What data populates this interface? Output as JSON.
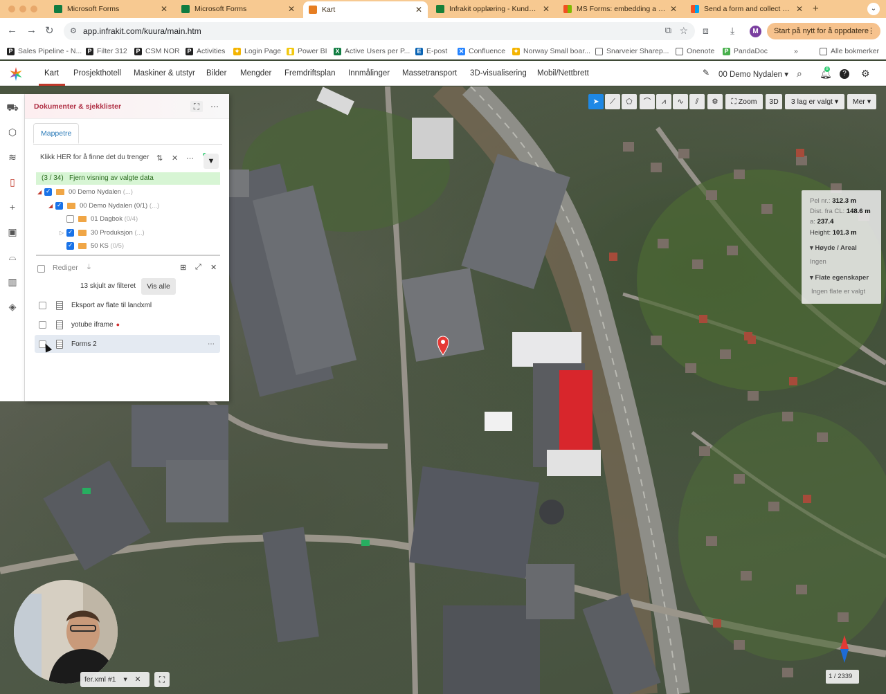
{
  "browser": {
    "tabs": [
      {
        "label": "Microsoft Forms",
        "color": "#107c41"
      },
      {
        "label": "Microsoft Forms",
        "color": "#107c41"
      },
      {
        "label": "Kart",
        "color": "#e67e22"
      },
      {
        "label": "Infrakit opplæring - Kundetilf",
        "color": "#188038"
      },
      {
        "label": "MS Forms: embedding a form",
        "color": "#f25022"
      },
      {
        "label": "Send a form and collect resp",
        "color": "#f25022"
      }
    ],
    "url": "app.infrakit.com/kuura/main.htm",
    "profile_initial": "M",
    "update_label": "Start på nytt for å oppdatere",
    "bookmarks": [
      "Sales Pipeline - N...",
      "Filter 312",
      "CSM NOR",
      "Activities",
      "Login Page",
      "Power BI",
      "Active Users per P...",
      "E-post",
      "Confluence",
      "Norway Small boar...",
      "Snarveier Sharep...",
      "Onenote",
      "PandaDoc"
    ],
    "all_bookmarks": "Alle bokmerker"
  },
  "app_nav": {
    "items": [
      "Kart",
      "Prosjekthotell",
      "Maskiner & utstyr",
      "Bilder",
      "Mengder",
      "Fremdriftsplan",
      "Innmålinger",
      "Massetransport",
      "3D-visualisering",
      "Mobil/Nettbrett"
    ],
    "project": "00 Demo Nydalen",
    "notification_count": "8"
  },
  "doc_panel": {
    "title": "Dokumenter & sjekklister",
    "tab": "Mappetre",
    "search_placeholder": "Klikk HER for å finne det du trenger",
    "selection_count": "(3 / 34)",
    "selection_action": "Fjern visning av valgte data",
    "tree": [
      {
        "label": "00 Demo Nydalen",
        "meta": "(...)",
        "checked": true
      },
      {
        "label": "00 Demo Nydalen (0/1)",
        "meta": "(...)",
        "checked": true
      },
      {
        "label": "01 Dagbok",
        "meta": "(0/4)",
        "checked": false
      },
      {
        "label": "30 Produksjon",
        "meta": "(...)",
        "checked": true
      },
      {
        "label": "50 KS",
        "meta": "(0/5)",
        "checked": true
      }
    ],
    "edit_label": "Rediger",
    "hidden_info": "13 skjult av filteret",
    "show_all": "Vis alle",
    "documents": [
      {
        "name": "Eksport av flate til landxml",
        "pinned": false
      },
      {
        "name": "yotube iframe",
        "pinned": true
      },
      {
        "name": "Forms 2",
        "pinned": false
      }
    ]
  },
  "map_toolbar": {
    "zoom": "Zoom",
    "view3d": "3D",
    "layers": "3 lag er valgt",
    "more": "Mer"
  },
  "info_panel": {
    "pel_label": "Pel nr.:",
    "pel_value": "312.3 m",
    "dist_label": "Dist. fra CL:",
    "dist_value": "148.6 m",
    "a_label": "a:",
    "a_value": "237.4",
    "height_label": "Height:",
    "height_value": "101.3 m",
    "section1": "Høyde / Areal",
    "section1_value": "Ingen",
    "section2": "Flate egenskaper",
    "section2_value": "Ingen flate er valgt"
  },
  "bottom": {
    "file_dropdown": "fer.xml #1",
    "scale_text": "1 / 2339"
  },
  "colors": {
    "accent_red": "#c0392b",
    "selection_blue": "#1e88e5",
    "browser_accent": "#f7c991"
  }
}
